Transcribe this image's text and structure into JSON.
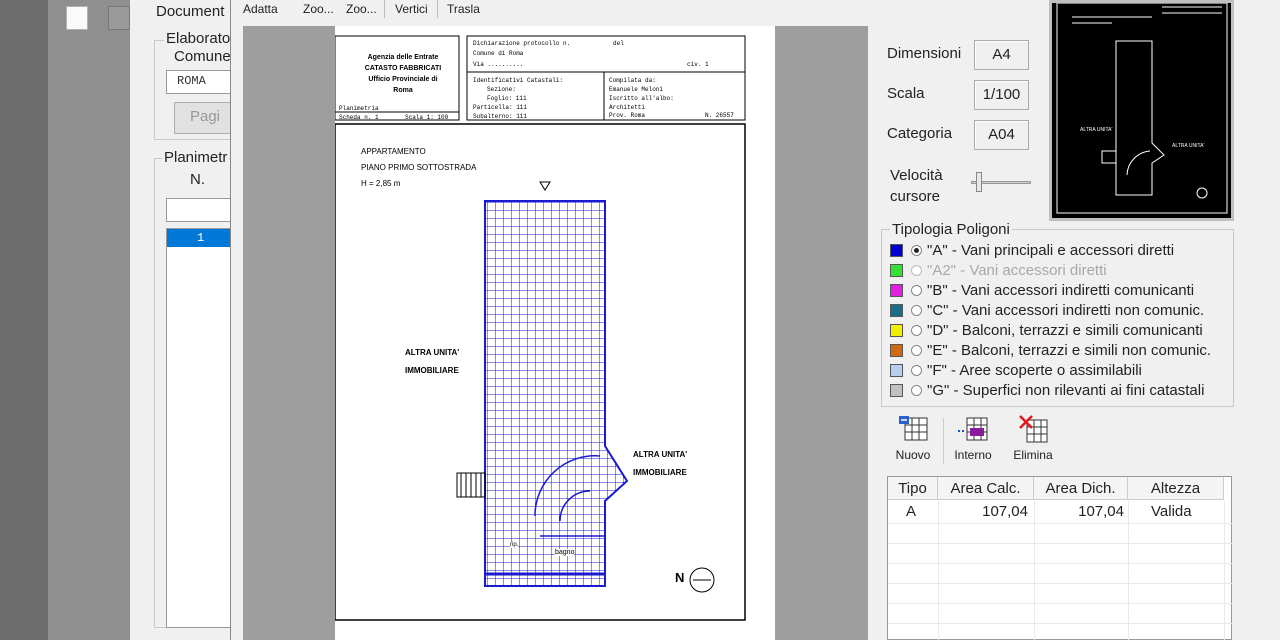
{
  "main_window": {
    "menu_document": "Document",
    "elaborato_label": "Elaborato",
    "comune_label": "Comune",
    "comune_value": "ROMA",
    "page_button": "Pagi",
    "planimetrie_label": "Planimetr",
    "n_label": "N.",
    "list_item": "1"
  },
  "toolbar": {
    "adatta": "Adatta",
    "zoom_in": "Zoo...",
    "zoom_out": "Zoo...",
    "vertici": "Vertici",
    "trasla": "Trasla"
  },
  "plan": {
    "office_line1": "Agenzia delle Entrate",
    "office_line2": "CATASTO FABBRICATI",
    "office_line3": "Ufficio Provinciale di",
    "office_line4": "Roma",
    "decl_label": "Dichiarazione protocollo n.",
    "decl_del": "del",
    "comune_line": "Comune di Roma",
    "via_line": "Via ..........",
    "civ_line": "civ. 1",
    "ident_label": "Identificativi Catastali:",
    "sezione": "Sezione:",
    "foglio": "Foglio: 111",
    "particella": "Particella: 111",
    "subalterno": "Subalterno: 111",
    "compilata": "Compilata da:",
    "compilata_name": "Emanuele Meloni",
    "iscritto": "Iscritto all'albo:",
    "albo": "Architetti",
    "prov": "Prov. Roma",
    "num": "N. 26557",
    "planimetria": "Planimetria",
    "scheda": "Scheda n. 1",
    "scala": "Scala 1: 100",
    "title1": "APPARTAMENTO",
    "title2": "PIANO PRIMO SOTTOSTRADA",
    "title3": "H = 2,85 m",
    "other1a": "ALTRA UNITA'",
    "other1b": "IMMOBILIARE",
    "other2a": "ALTRA UNITA'",
    "other2b": "IMMOBILIARE",
    "room_bagno": "bagno",
    "room_rip": "rip.",
    "north": "N"
  },
  "properties": {
    "dimensioni_label": "Dimensioni",
    "dimensioni_value": "A4",
    "scala_label": "Scala",
    "scala_value": "1/100",
    "categoria_label": "Categoria",
    "categoria_value": "A04",
    "velocita_label1": "Velocità",
    "velocita_label2": "cursore"
  },
  "thumbnail": {
    "label1": "ALTRA UNITA'",
    "label2": "ALTRA UNITA'"
  },
  "tipologia": {
    "title": "Tipologia Poligoni",
    "items": [
      {
        "label": "\"A\" - Vani principali e accessori diretti",
        "color": "#0000d0",
        "selected": true,
        "enabled": true
      },
      {
        "label": "\"A2\" - Vani accessori diretti",
        "color": "#33e033",
        "selected": false,
        "enabled": false
      },
      {
        "label": "\"B\" - Vani accessori indiretti comunicanti",
        "color": "#e020e0",
        "selected": false,
        "enabled": true
      },
      {
        "label": "\"C\" - Vani accessori indiretti non comunic.",
        "color": "#1a6e8a",
        "selected": false,
        "enabled": true
      },
      {
        "label": "\"D\" - Balconi, terrazzi e simili comunicanti",
        "color": "#f0f000",
        "selected": false,
        "enabled": true
      },
      {
        "label": "\"E\" - Balconi, terrazzi e simili non comunic.",
        "color": "#d06a10",
        "selected": false,
        "enabled": true
      },
      {
        "label": "\"F\" - Aree scoperte o assimilabili",
        "color": "#b9cdf0",
        "selected": false,
        "enabled": true
      },
      {
        "label": "\"G\" - Superfici non rilevanti ai fini catastali",
        "color": "#c0c0c0",
        "selected": false,
        "enabled": true
      }
    ]
  },
  "tools": {
    "nuovo": "Nuovo",
    "interno": "Interno",
    "elimina": "Elimina"
  },
  "grid": {
    "headers": [
      "Tipo",
      "Area Calc.",
      "Area Dich.",
      "Altezza"
    ],
    "rows": [
      [
        "A",
        "107,04",
        "107,04",
        "Valida"
      ]
    ]
  }
}
